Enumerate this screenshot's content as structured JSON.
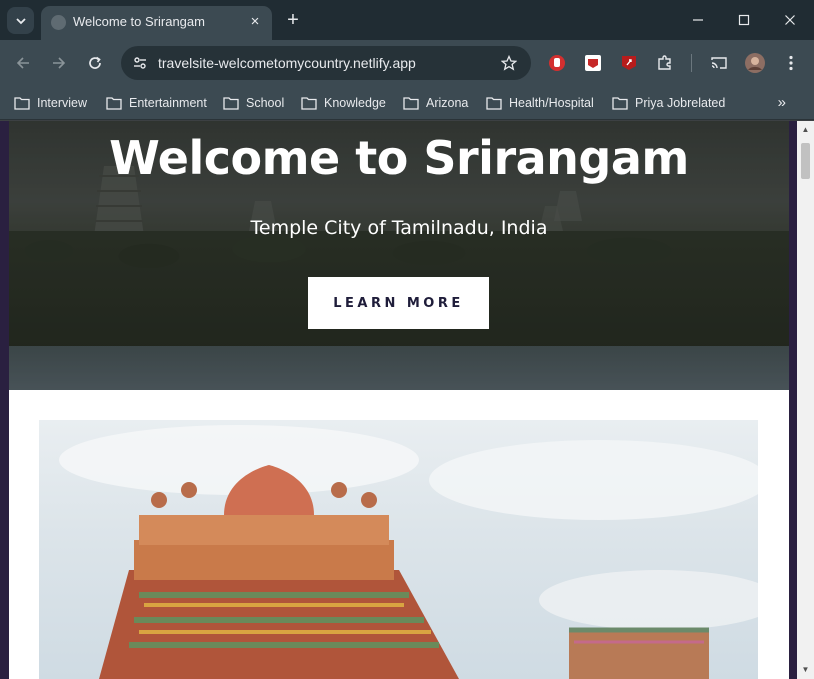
{
  "browser": {
    "tab_title": "Welcome to Srirangam",
    "tab_close": "×",
    "new_tab": "+",
    "url": "travelsite-welcometomycountry.netlify.app",
    "bookmarks": [
      {
        "label": "Interview"
      },
      {
        "label": "Entertainment"
      },
      {
        "label": "School"
      },
      {
        "label": "Knowledge"
      },
      {
        "label": "Arizona"
      },
      {
        "label": "Health/Hospital"
      },
      {
        "label": "Priya Jobrelated"
      }
    ],
    "bookmarks_more": "»"
  },
  "page": {
    "hero": {
      "title": "Welcome to Srirangam",
      "subtitle": "Temple City of Tamilnadu, India",
      "button_label": "LEARN MORE"
    }
  },
  "colors": {
    "tab_strip": "#202c33",
    "toolbar": "#3c4a52",
    "button_text": "#1f1d3a",
    "page_border": "#2a2040"
  }
}
